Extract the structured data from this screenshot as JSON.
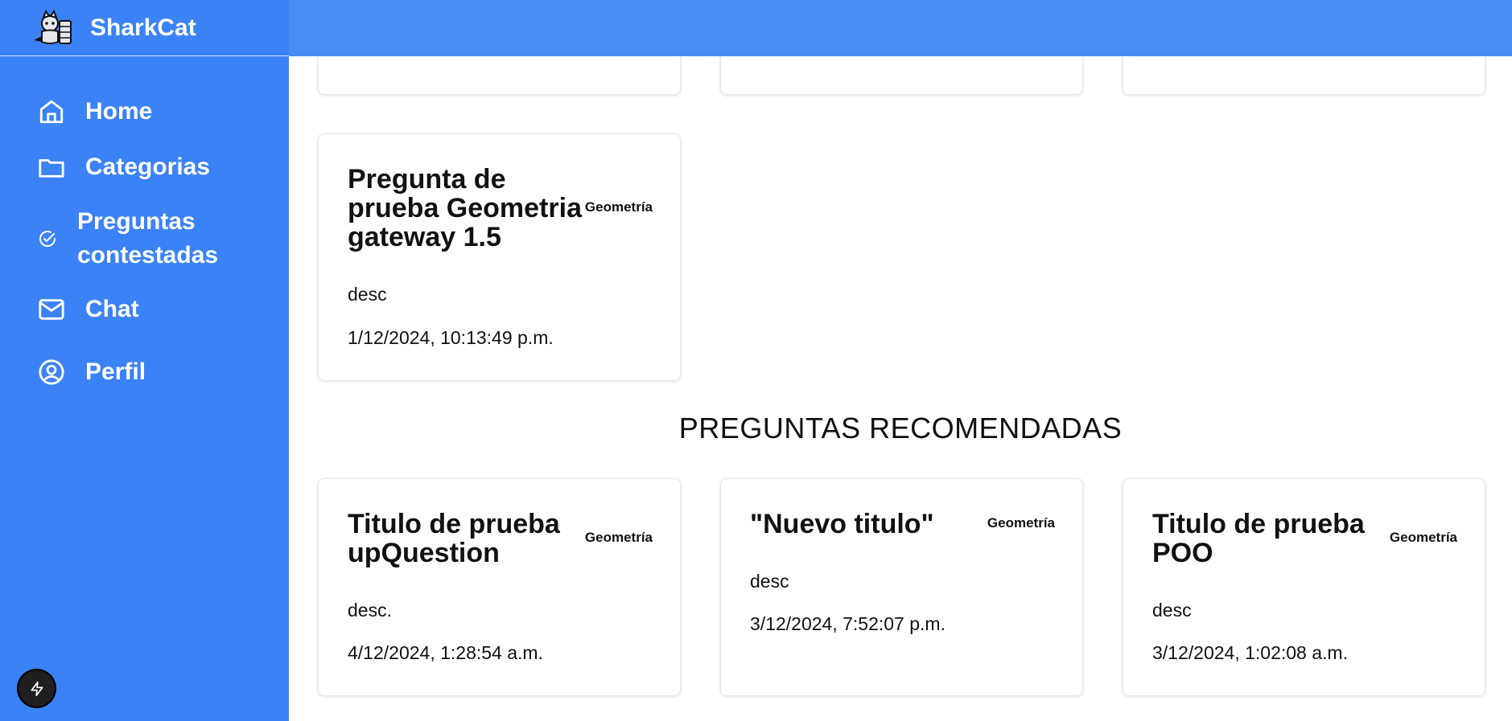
{
  "app": {
    "name": "SharkCat",
    "accent": "#3b82f6"
  },
  "sidebar": {
    "items": [
      {
        "label": "Home",
        "icon": "home-icon"
      },
      {
        "label": "Categorias",
        "icon": "folder-icon"
      },
      {
        "label": "Preguntas\ncontestadas",
        "icon": "check-circle-icon"
      },
      {
        "label": "Chat",
        "icon": "mail-icon"
      },
      {
        "label": "Perfil",
        "icon": "user-circle-icon"
      }
    ]
  },
  "featured": {
    "title": "Pregunta de prueba Geometria gateway 1.5",
    "category": "Geometría",
    "desc": "desc",
    "date": "1/12/2024, 10:13:49 p.m."
  },
  "recommended": {
    "heading": "PREGUNTAS RECOMENDADAS",
    "cards": [
      {
        "title": "Titulo de prueba upQuestion",
        "category": "Geometría",
        "desc": "desc.",
        "date": "4/12/2024, 1:28:54 a.m."
      },
      {
        "title": "\"Nuevo titulo\"",
        "category": "Geometría",
        "desc": "desc",
        "date": "3/12/2024, 7:52:07 p.m."
      },
      {
        "title": "Titulo de prueba POO",
        "category": "Geometría",
        "desc": "desc",
        "date": "3/12/2024, 1:02:08 a.m."
      }
    ]
  }
}
